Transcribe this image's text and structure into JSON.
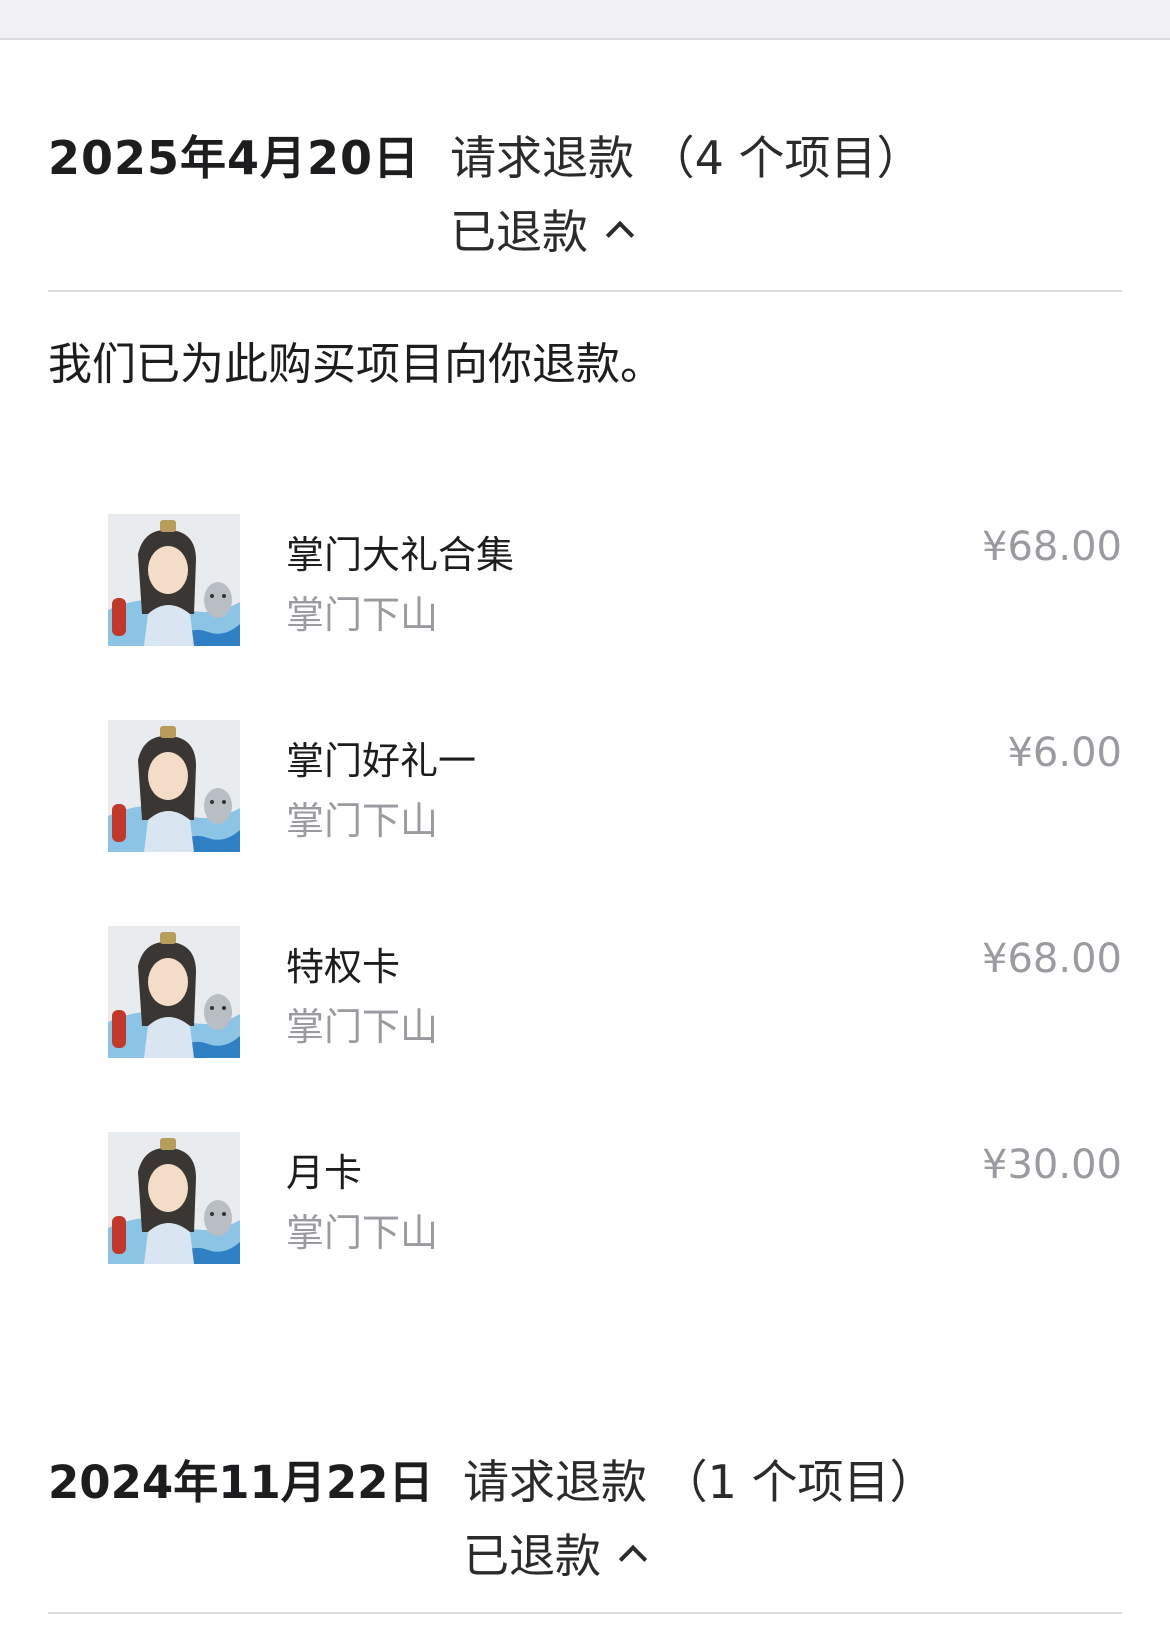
{
  "groups": [
    {
      "date": "2025年4月20日",
      "request": "请求退款 （4 个项目）",
      "status": "已退款",
      "note": "我们已为此购买项目向你退款。",
      "items": [
        {
          "name": "掌门大礼合集",
          "app": "掌门下山",
          "price": "¥68.00"
        },
        {
          "name": "掌门好礼一",
          "app": "掌门下山",
          "price": "¥6.00"
        },
        {
          "name": "特权卡",
          "app": "掌门下山",
          "price": "¥68.00"
        },
        {
          "name": "月卡",
          "app": "掌门下山",
          "price": "¥30.00"
        }
      ]
    },
    {
      "date": "2024年11月22日",
      "request": "请求退款 （1 个项目）",
      "status": "已退款"
    }
  ],
  "colors": {
    "primary_text": "#1d1d1f",
    "secondary_text": "#9a9aa0",
    "divider": "#dcdcdf",
    "background": "#ffffff"
  },
  "icons": {
    "expand": "chevron-up-icon",
    "thumbnail": "game-app-icon"
  }
}
